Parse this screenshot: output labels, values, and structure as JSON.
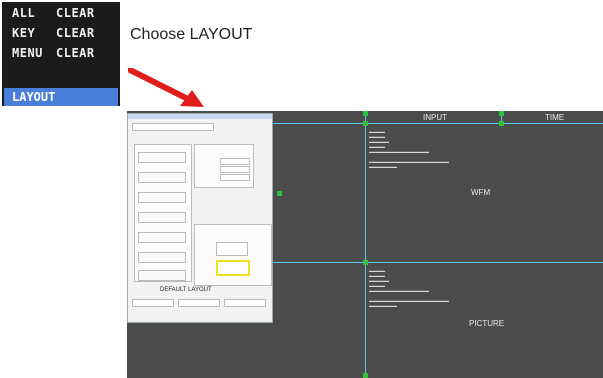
{
  "menu": {
    "items": [
      {
        "key": "ALL",
        "value": "CLEAR"
      },
      {
        "key": "KEY",
        "value": "CLEAR"
      },
      {
        "key": "MENU",
        "value": "CLEAR"
      }
    ],
    "selected": "LAYOUT"
  },
  "caption": "Choose LAYOUT",
  "screen": {
    "header_cells": [
      "INPUT",
      "TIME"
    ],
    "window_1_label": "WFM",
    "window_2_label": "PICTURE"
  },
  "dialog": {
    "default_layout_label": "DEFAULT LAYOUT"
  },
  "colors": {
    "menu_bg": "#1b1b1b",
    "menu_selected": "#4a7fd9",
    "arrow": "#e21b1b",
    "divider": "#5cc6e8",
    "marker": "#2ec43a"
  }
}
